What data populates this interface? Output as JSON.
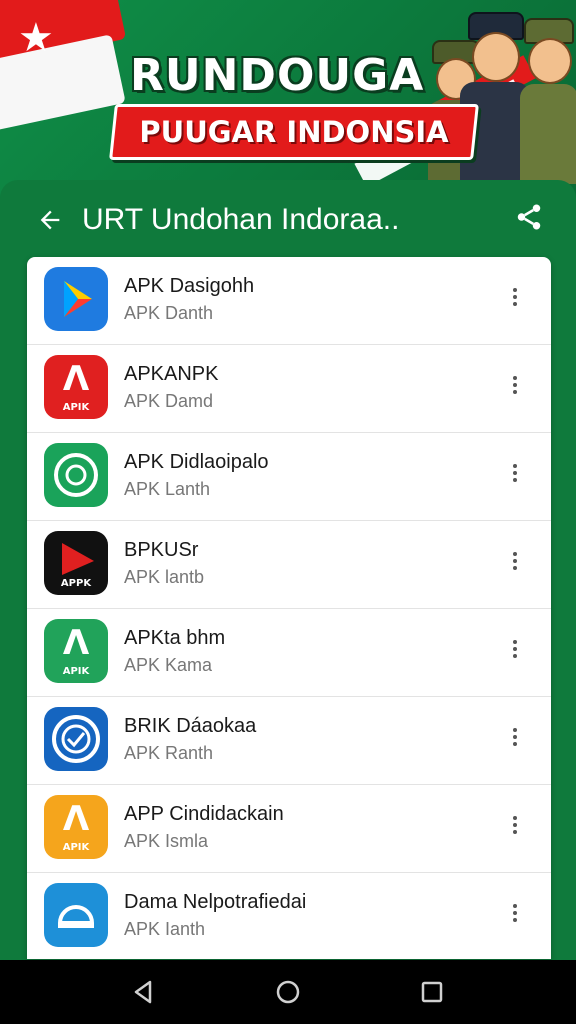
{
  "banner": {
    "title": "RUNDOUGA",
    "subtitle": "PUUGAR INDONSIA"
  },
  "appbar": {
    "back_icon": "arrow-left-icon",
    "title": "URT Undohan Indoraa..",
    "share_icon": "share-icon"
  },
  "apps": [
    {
      "name": "APK Dasigohh",
      "sub": "APK Danth",
      "icon": "play-store-icon",
      "icon_color": "#1f7be0",
      "icon_tag": ""
    },
    {
      "name": "APKANPK",
      "sub": "APK Damd",
      "icon": "letter-a-icon",
      "icon_color": "#e02020",
      "icon_tag": "APIK"
    },
    {
      "name": "APK Didlaoipalo",
      "sub": "APK Lanth",
      "icon": "whatsapp-like-icon",
      "icon_color": "#1aa35a",
      "icon_tag": ""
    },
    {
      "name": "BPKUSr",
      "sub": "APK lantb",
      "icon": "red-play-icon",
      "icon_color": "#111111",
      "icon_tag": "APPK"
    },
    {
      "name": "APKta bhm",
      "sub": "APK Kama",
      "icon": "letter-a-icon",
      "icon_color": "#21a35a",
      "icon_tag": "APIK"
    },
    {
      "name": "BRIK Dáaokaa",
      "sub": "APK Ranth",
      "icon": "globe-icon",
      "icon_color": "#1565c0",
      "icon_tag": ""
    },
    {
      "name": "APP Cindidackain",
      "sub": "APK Ismla",
      "icon": "letter-a-icon",
      "icon_color": "#f5a51c",
      "icon_tag": "APIK"
    },
    {
      "name": "Dama Nelpotrafiedai",
      "sub": "APK Ianth",
      "icon": "cloud-icon",
      "icon_color": "#1e90d8",
      "icon_tag": ""
    }
  ],
  "more_icon": "more-vertical-icon",
  "navbar": {
    "back": "nav-back-icon",
    "home": "nav-home-icon",
    "recents": "nav-recents-icon"
  },
  "colors": {
    "green": "#0f7a3c",
    "red": "#e21b1b",
    "yellow": "#f5c400"
  }
}
